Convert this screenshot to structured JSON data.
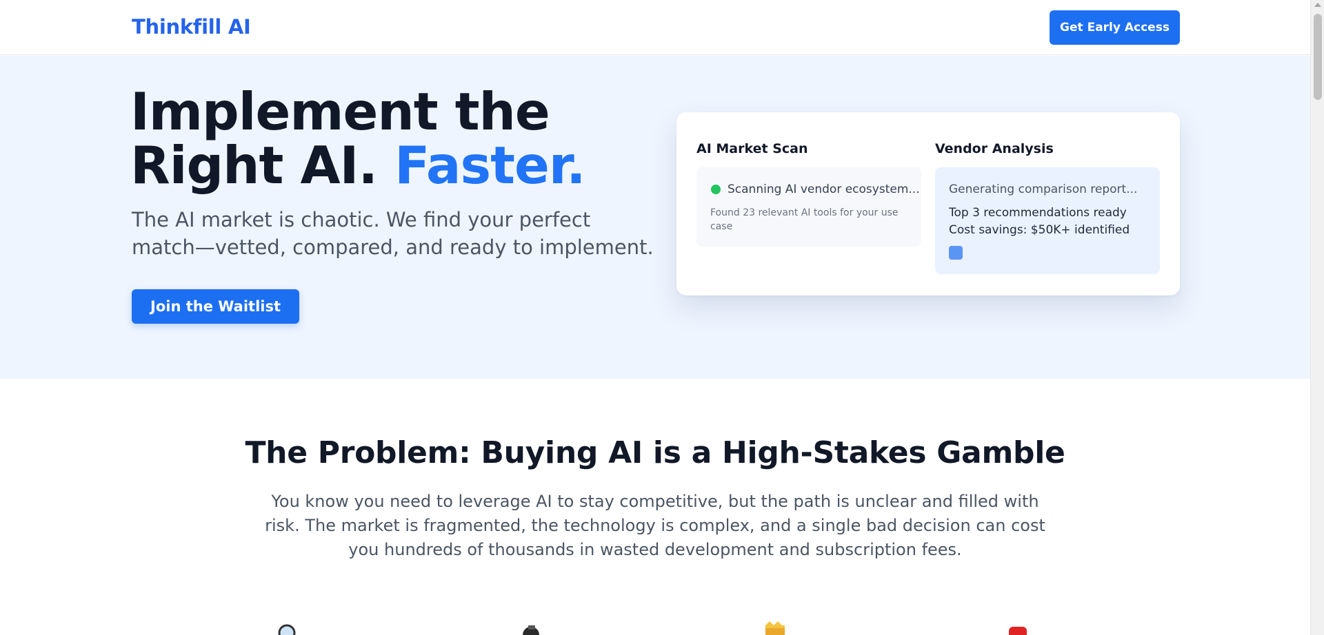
{
  "header": {
    "logo": "Thinkfill AI",
    "cta_label": "Get Early Access"
  },
  "hero": {
    "title_line1": "Implement the",
    "title_line2_prefix": "Right AI.",
    "title_line2_accent": "Faster.",
    "subtitle": "The AI market is chaotic. We find your perfect match—vetted, compared, and ready to implement.",
    "cta_label": "Join the Waitlist",
    "card": {
      "scan": {
        "title": "AI Market Scan",
        "status": "Scanning AI vendor ecosystem...",
        "found": "Found 23 relevant AI tools for your use case"
      },
      "vendor": {
        "title": "Vendor Analysis",
        "status": "Generating comparison report...",
        "line1": "Top 3 recommendations ready",
        "line2": "Cost savings: $50K+ identified"
      }
    }
  },
  "problem": {
    "title": "The Problem: Buying AI is a High-Stakes Gamble",
    "text": "You know you need to leverage AI to stay competitive, but the path is unclear and filled with risk. The market is fragmented, the technology is complex, and a single bad decision can cost you hundreds of thousands in wasted development and subscription fees."
  },
  "feature_icons": [
    "magnifier-icon",
    "bomb-icon",
    "crown-icon",
    "red-alert-icon"
  ],
  "colors": {
    "brand": "#2563eb",
    "button": "#1d6ff2",
    "hero_bg": "#eff5ff",
    "status_green": "#22c55e"
  }
}
